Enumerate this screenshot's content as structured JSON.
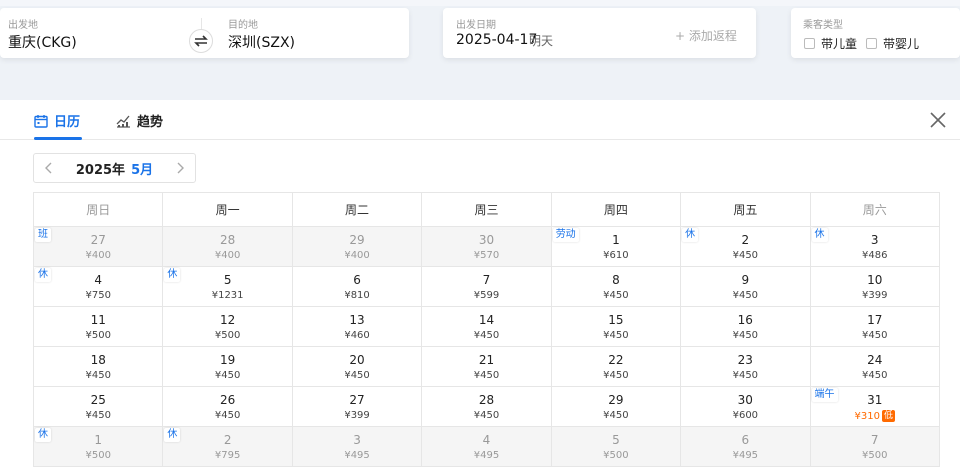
{
  "search": {
    "depart_label": "出发地",
    "depart_value": "重庆(CKG)",
    "arrive_label": "目的地",
    "arrive_value": "深圳(SZX)",
    "date_label": "出发日期",
    "date_value": "2025-04-17",
    "date_hint": "明天",
    "add_return": "+ 添加返程",
    "pax_label": "乘客类型",
    "child_label": "带儿童",
    "infant_label": "带婴儿"
  },
  "tabs": {
    "calendar": "日历",
    "trend": "趋势"
  },
  "month_nav": {
    "year": "2025年",
    "month": "5月"
  },
  "weekdays": [
    "周日",
    "周一",
    "周二",
    "周三",
    "周四",
    "周五",
    "周六"
  ],
  "weeks": [
    [
      {
        "day": "27",
        "price": "¥400",
        "other": true,
        "tag": "班"
      },
      {
        "day": "28",
        "price": "¥400",
        "other": true
      },
      {
        "day": "29",
        "price": "¥400",
        "other": true
      },
      {
        "day": "30",
        "price": "¥570",
        "other": true
      },
      {
        "day": "1",
        "price": "¥610",
        "tag": "劳动"
      },
      {
        "day": "2",
        "price": "¥450",
        "tag": "休"
      },
      {
        "day": "3",
        "price": "¥486",
        "tag": "休"
      }
    ],
    [
      {
        "day": "4",
        "price": "¥750",
        "tag": "休"
      },
      {
        "day": "5",
        "price": "¥1231",
        "tag": "休"
      },
      {
        "day": "6",
        "price": "¥810"
      },
      {
        "day": "7",
        "price": "¥599"
      },
      {
        "day": "8",
        "price": "¥450"
      },
      {
        "day": "9",
        "price": "¥450"
      },
      {
        "day": "10",
        "price": "¥399"
      }
    ],
    [
      {
        "day": "11",
        "price": "¥500"
      },
      {
        "day": "12",
        "price": "¥500"
      },
      {
        "day": "13",
        "price": "¥460"
      },
      {
        "day": "14",
        "price": "¥450"
      },
      {
        "day": "15",
        "price": "¥450"
      },
      {
        "day": "16",
        "price": "¥450"
      },
      {
        "day": "17",
        "price": "¥450"
      }
    ],
    [
      {
        "day": "18",
        "price": "¥450"
      },
      {
        "day": "19",
        "price": "¥450"
      },
      {
        "day": "20",
        "price": "¥450"
      },
      {
        "day": "21",
        "price": "¥450"
      },
      {
        "day": "22",
        "price": "¥450"
      },
      {
        "day": "23",
        "price": "¥450"
      },
      {
        "day": "24",
        "price": "¥450"
      }
    ],
    [
      {
        "day": "25",
        "price": "¥450"
      },
      {
        "day": "26",
        "price": "¥450"
      },
      {
        "day": "27",
        "price": "¥399"
      },
      {
        "day": "28",
        "price": "¥450"
      },
      {
        "day": "29",
        "price": "¥450"
      },
      {
        "day": "30",
        "price": "¥600"
      },
      {
        "day": "31",
        "price": "¥310",
        "tag": "端午",
        "low": "低"
      }
    ],
    [
      {
        "day": "1",
        "price": "¥500",
        "other": true,
        "tag": "休"
      },
      {
        "day": "2",
        "price": "¥795",
        "other": true,
        "tag": "休"
      },
      {
        "day": "3",
        "price": "¥495",
        "other": true
      },
      {
        "day": "4",
        "price": "¥495",
        "other": true
      },
      {
        "day": "5",
        "price": "¥500",
        "other": true
      },
      {
        "day": "6",
        "price": "¥495",
        "other": true
      },
      {
        "day": "7",
        "price": "¥500",
        "other": true
      }
    ]
  ],
  "colors": {
    "accent": "#1a73e8",
    "low_price": "#ff6a00"
  }
}
